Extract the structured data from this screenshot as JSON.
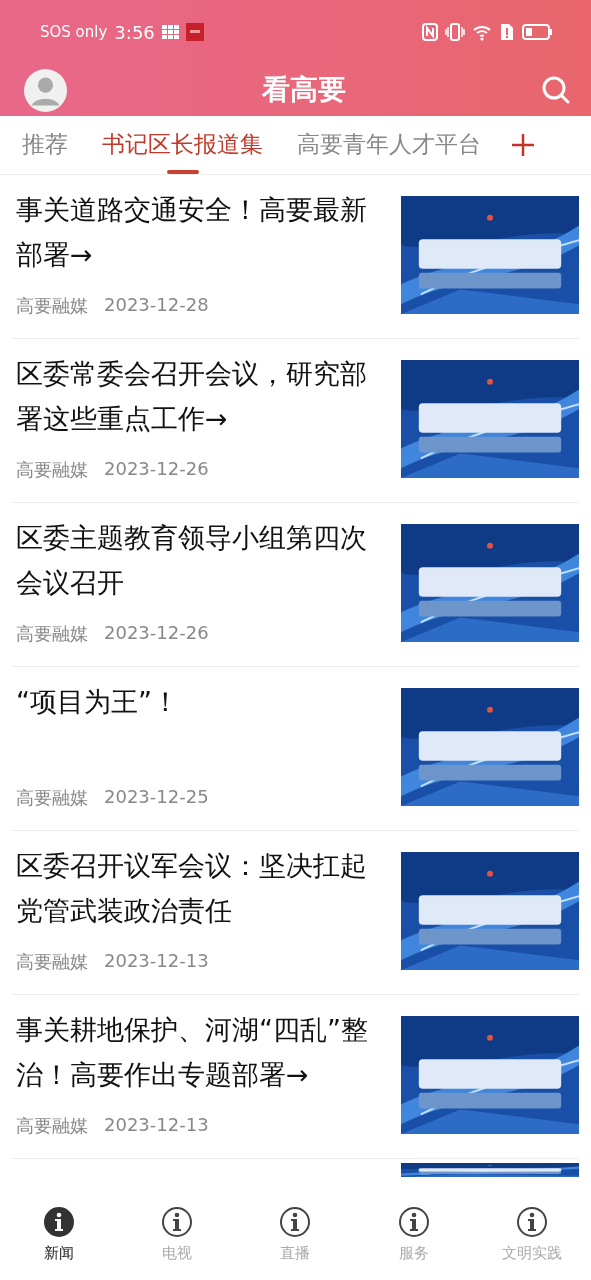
{
  "status_bar": {
    "carrier": "SOS only",
    "time": "3:56"
  },
  "header": {
    "title": "看高要"
  },
  "tabs": [
    {
      "label": "推荐",
      "selected": false
    },
    {
      "label": "书记区长报道集",
      "selected": true
    },
    {
      "label": "高要青年人才平台",
      "selected": false
    }
  ],
  "articles": [
    {
      "title": "事关道路交通安全！高要最新部署→",
      "source": "高要融媒",
      "date": "2023-12-28",
      "thumbnail": {
        "kind": "picture"
      }
    },
    {
      "title": "区委常委会召开会议，研究部署这些重点工作→",
      "source": "高要融媒",
      "date": "2023-12-26",
      "thumbnail": {
        "kind": "picture"
      }
    },
    {
      "title": "区委主题教育领导小组第四次会议召开",
      "source": "高要融媒",
      "date": "2023-12-26",
      "thumbnail": {
        "kind": "picture"
      }
    },
    {
      "title": "“项目为王”！",
      "source": "高要融媒",
      "date": "2023-12-25",
      "thumbnail": {
        "kind": "picture"
      }
    },
    {
      "title": "区委召开议军会议：坚决扛起党管武装政治责任",
      "source": "高要融媒",
      "date": "2023-12-13",
      "thumbnail": {
        "kind": "picture"
      }
    },
    {
      "title": "事关耕地保护、河湖“四乱”整治！高要作出专题部署→",
      "source": "高要融媒",
      "date": "2023-12-13",
      "thumbnail": {
        "kind": "picture"
      }
    },
    {
      "thumbnail": {
        "kind": "picture"
      }
    }
  ],
  "bottom_nav": [
    {
      "label": "新闻",
      "selected": true
    },
    {
      "label": "电视",
      "selected": false
    },
    {
      "label": "直播",
      "selected": false
    },
    {
      "label": "服务",
      "selected": false
    },
    {
      "label": "文明实践",
      "selected": false
    }
  ]
}
